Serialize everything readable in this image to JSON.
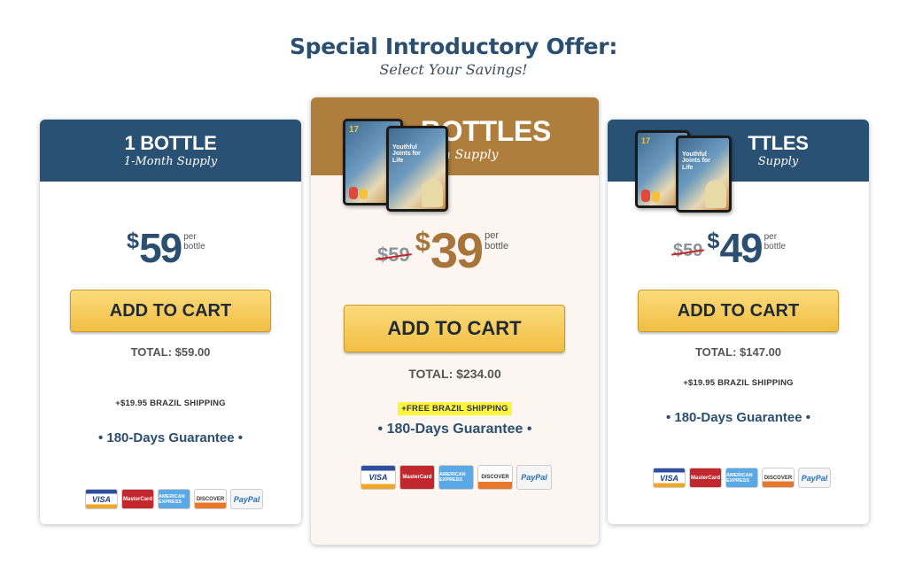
{
  "header": {
    "title": "Special Introductory Offer:",
    "subtitle": "Select Your Savings!"
  },
  "colors": {
    "heading_blue": "#2b4f70",
    "card_head_blue": "#285174",
    "card_head_gold": "#b07e3c",
    "button_gold": "#f2be44",
    "highlight_yellow": "#fbf542",
    "strike_red": "#c62828"
  },
  "packages": [
    {
      "title": "1 BOTTLE",
      "subtitle": "1-Month Supply",
      "currency": "$",
      "price": "59",
      "per_label_1": "per",
      "per_label_2": "bottle",
      "cta": "ADD TO CART",
      "total": "TOTAL: $59.00",
      "shipping": "+$19.95 BRAZIL SHIPPING",
      "guarantee": "• 180-Days Guarantee •"
    },
    {
      "title": "BOTTLES",
      "subtitle": "th Supply",
      "old_price": "$59",
      "currency": "$",
      "price": "39",
      "per_label_1": "per",
      "per_label_2": "bottle",
      "cta": "ADD TO CART",
      "total": "TOTAL: $234.00",
      "shipping": "+FREE BRAZIL SHIPPING",
      "guarantee": "• 180-Days Guarantee •",
      "ebook_badge": "17",
      "ebook_front_title": "Youthful Joints for Life"
    },
    {
      "title": "TTLES",
      "subtitle": "Supply",
      "old_price": "$59",
      "currency": "$",
      "price": "49",
      "per_label_1": "per",
      "per_label_2": "bottle",
      "cta": "ADD TO CART",
      "total": "TOTAL: $147.00",
      "shipping": "+$19.95 BRAZIL SHIPPING",
      "guarantee": "• 180-Days Guarantee •",
      "ebook_badge": "17",
      "ebook_front_title": "Youthful Joints for Life"
    }
  ],
  "payment_methods": [
    {
      "label": "VISA",
      "icon": "visa-icon"
    },
    {
      "label": "MasterCard",
      "icon": "mastercard-icon"
    },
    {
      "label": "AMERICAN EXPRESS",
      "icon": "amex-icon"
    },
    {
      "label": "DISCOVER",
      "icon": "discover-icon"
    },
    {
      "label": "PayPal",
      "icon": "paypal-icon"
    }
  ]
}
